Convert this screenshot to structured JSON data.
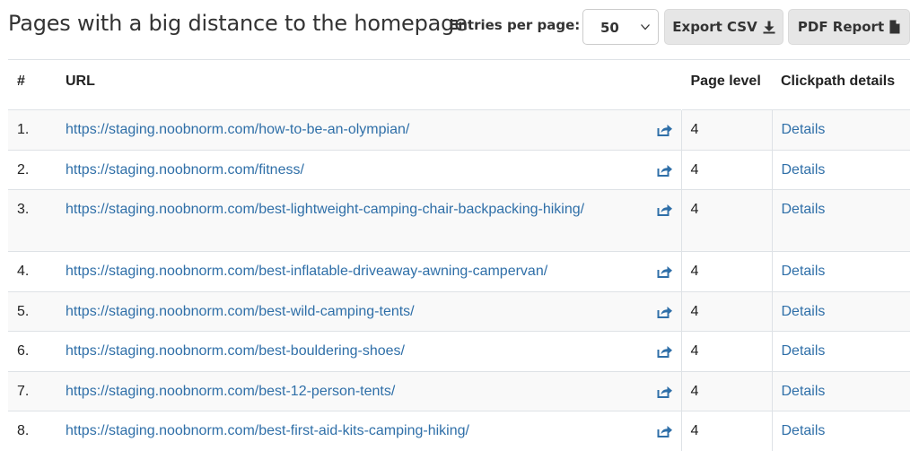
{
  "header": {
    "title": "Pages with a big distance to the homepage",
    "entries_label": "Entries per page:",
    "entries_value": "50",
    "export_csv_label": "Export CSV",
    "pdf_report_label": "PDF Report"
  },
  "icons": {
    "select": "chevron-down-icon",
    "export": "download-icon",
    "pdf": "file-icon",
    "row_link": "share-icon"
  },
  "colors": {
    "link": "#2f6fa8",
    "button_bg": "#e6e6e6",
    "stripe": "#f9f9f9"
  },
  "table": {
    "headers": {
      "index": "#",
      "url": "URL",
      "level": "Page level",
      "details": "Clickpath details"
    },
    "rows": [
      {
        "index": "1.",
        "url": "https://staging.noobnorm.com/how-to-be-an-olympian/",
        "level": "4",
        "details": "Details"
      },
      {
        "index": "2.",
        "url": "https://staging.noobnorm.com/fitness/",
        "level": "4",
        "details": "Details"
      },
      {
        "index": "3.",
        "url": "https://staging.noobnorm.com/best-lightweight-camping-chair-backpacking-hiking/",
        "level": "4",
        "details": "Details"
      },
      {
        "index": "4.",
        "url": "https://staging.noobnorm.com/best-inflatable-driveaway-awning-campervan/",
        "level": "4",
        "details": "Details"
      },
      {
        "index": "5.",
        "url": "https://staging.noobnorm.com/best-wild-camping-tents/",
        "level": "4",
        "details": "Details"
      },
      {
        "index": "6.",
        "url": "https://staging.noobnorm.com/best-bouldering-shoes/",
        "level": "4",
        "details": "Details"
      },
      {
        "index": "7.",
        "url": "https://staging.noobnorm.com/best-12-person-tents/",
        "level": "4",
        "details": "Details"
      },
      {
        "index": "8.",
        "url": "https://staging.noobnorm.com/best-first-aid-kits-camping-hiking/",
        "level": "4",
        "details": "Details"
      }
    ]
  }
}
